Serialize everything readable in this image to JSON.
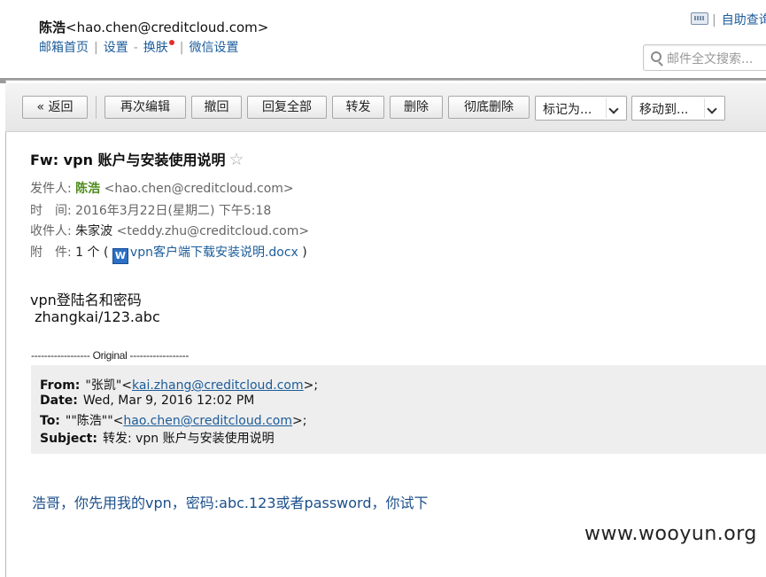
{
  "header": {
    "user_name": "陈浩",
    "user_email": "<hao.chen@creditcloud.com>",
    "nav_home": "邮箱首页",
    "nav_settings": "设置",
    "nav_dash": "-",
    "nav_skin": "换肤",
    "nav_wechat": "微信设置",
    "self_query": "自助查询",
    "search_placeholder": "邮件全文搜索..."
  },
  "toolbar": {
    "back": "« 返回",
    "edit_again": "再次编辑",
    "recall": "撤回",
    "reply_all": "回复全部",
    "forward": "转发",
    "delete": "删除",
    "delete_permanently": "彻底删除",
    "mark_as": "标记为...",
    "move_to": "移动到..."
  },
  "mail": {
    "subject": "Fw: vpn 账户与安装使用说明",
    "from_label": "发件人:",
    "from_name": "陈浩",
    "from_email": "<hao.chen@creditcloud.com>",
    "time_label": "时　间:",
    "time_value": "2016年3月22日(星期二) 下午5:18",
    "to_label": "收件人:",
    "to_name": "朱家波",
    "to_email": "<teddy.zhu@creditcloud.com>",
    "attach_label": "附　件:",
    "attach_count": "1 个 (",
    "attach_icon": "W",
    "attach_name": "vpn客户端下载安装说明.docx",
    "attach_close": ")"
  },
  "body": {
    "line1": "vpn登陆名和密码",
    "line2": " zhangkai/123.abc",
    "original_sep": "------------------ Original ------------------",
    "quote": {
      "from_label": "From:",
      "from_name": "\"张凯\"<",
      "from_email": "kai.zhang@creditcloud.com",
      "from_end": ">;",
      "date_label": "Date:",
      "date_value": "Wed, Mar 9, 2016 12:02 PM",
      "to_label": "To:",
      "to_name": "\"\"陈浩\"\"<",
      "to_email": "hao.chen@creditcloud.com",
      "to_end": ">;",
      "subject_label": "Subject:",
      "subject_value": "转发: vpn 账户与安装使用说明"
    },
    "reply_line": "浩哥，你先用我的vpn，密码:abc.123或者password，你试下"
  },
  "watermark": "www.wooyun.org"
}
